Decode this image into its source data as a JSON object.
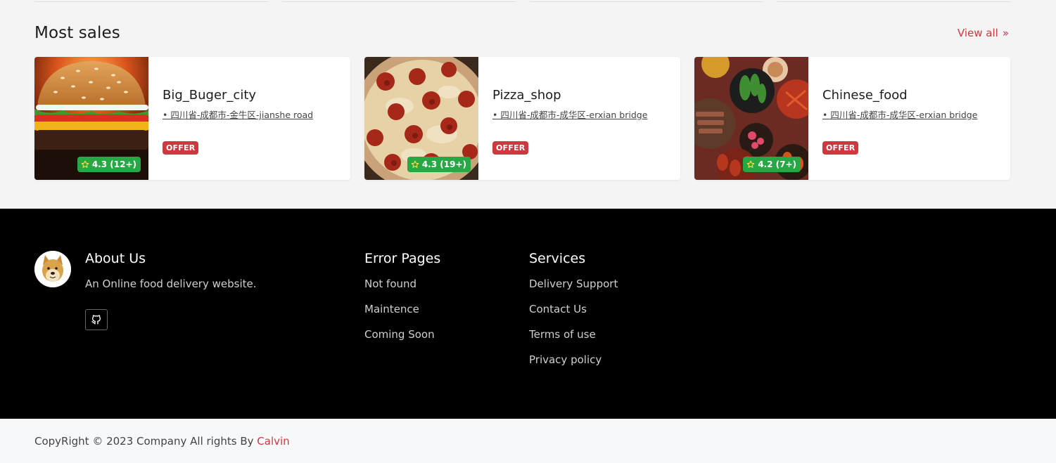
{
  "section": {
    "title": "Most sales",
    "view_all": "View all",
    "view_all_icon": "double-chevron-right-icon"
  },
  "restaurants": [
    {
      "name": "Big_Buger_city",
      "address": "• 四川省-成都市-金牛区-jianshe road",
      "badge": "OFFER",
      "rating": "4.3 (12+)",
      "image": "burger"
    },
    {
      "name": "Pizza_shop",
      "address": "• 四川省-成都市-成华区-erxian bridge",
      "badge": "OFFER",
      "rating": "4.3 (19+)",
      "image": "pizza"
    },
    {
      "name": "Chinese_food",
      "address": "• 四川省-成都市-成华区-erxian bridge",
      "badge": "OFFER",
      "rating": "4.2 (7+)",
      "image": "chinese-dishes"
    }
  ],
  "footer": {
    "about": {
      "title": "About Us",
      "description": "An Online food delivery website.",
      "logo": "doge-avatar",
      "github_icon": "github-icon"
    },
    "error_pages": {
      "title": "Error Pages",
      "links": [
        "Not found",
        "Maintence",
        "Coming Soon"
      ]
    },
    "services": {
      "title": "Services",
      "links": [
        "Delivery Support",
        "Contact Us",
        "Terms of use",
        "Privacy policy"
      ]
    }
  },
  "copyright": {
    "text": "CopyRight © 2023 Company All rights By ",
    "author": "Calvin"
  },
  "colors": {
    "accent": "#d1373f",
    "rating_green": "#28a745",
    "footer_bg": "#000000",
    "page_bg": "#f4f4f4"
  }
}
